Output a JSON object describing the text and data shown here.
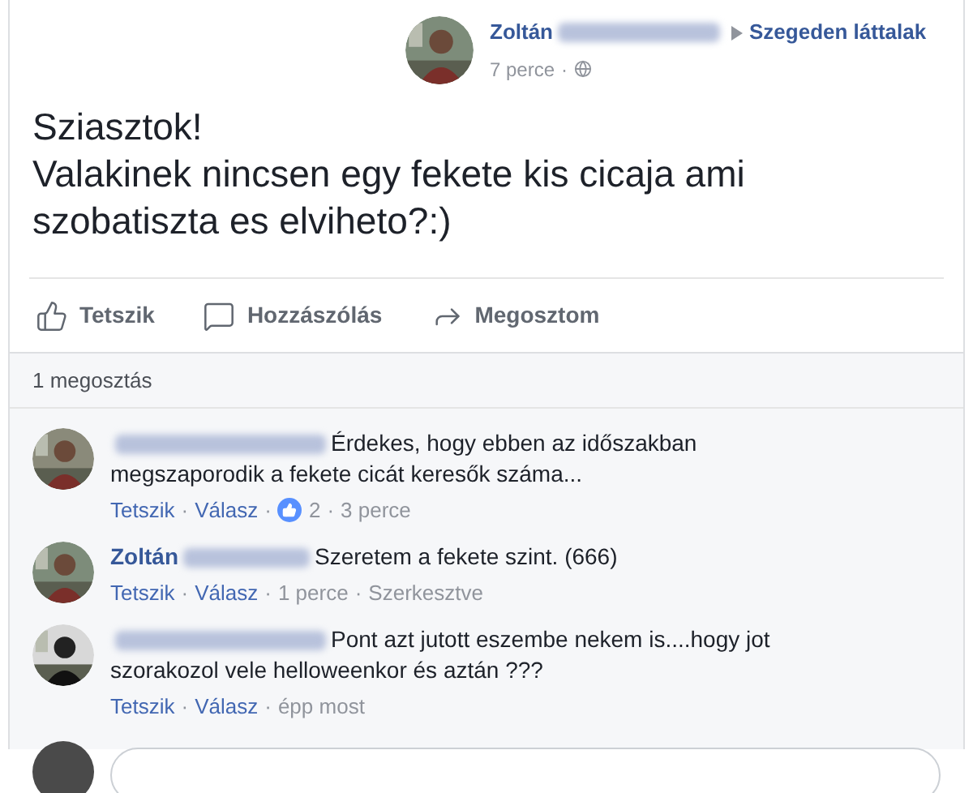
{
  "post": {
    "author": "Zoltán",
    "target": "Szegeden láttalak",
    "time": "7 perce",
    "separator": "·",
    "text_lines": [
      "Sziasztok!",
      "Valakinek nincsen egy fekete kis cicaja ami szobatiszta es elviheto?:)"
    ]
  },
  "actions": [
    "Tetszik",
    "Hozzászólás",
    "Megosztom"
  ],
  "shares": "1 megosztás",
  "comments": [
    {
      "text": "Érdekes, hogy ebben az időszakban megszaporodik a fekete cicát keresők száma...",
      "meta": [
        {
          "kind": "link",
          "text": "Tetszik"
        },
        {
          "kind": "sep",
          "text": "·"
        },
        {
          "kind": "link",
          "text": "Válasz"
        },
        {
          "kind": "sep",
          "text": "·"
        },
        {
          "kind": "likes",
          "text": "2"
        },
        {
          "kind": "sep",
          "text": "·"
        },
        {
          "kind": "time",
          "text": "3 perce"
        }
      ]
    },
    {
      "author_visible": "Zoltán",
      "text": "Szeretem a fekete szint. (666)",
      "meta": [
        {
          "kind": "link",
          "text": "Tetszik"
        },
        {
          "kind": "sep",
          "text": "·"
        },
        {
          "kind": "link",
          "text": "Válasz"
        },
        {
          "kind": "sep",
          "text": "·"
        },
        {
          "kind": "time",
          "text": "1 perce"
        },
        {
          "kind": "sep",
          "text": "·"
        },
        {
          "kind": "time",
          "text": "Szerkesztve"
        }
      ]
    },
    {
      "text": "Pont azt jutott eszembe nekem is....hogy jot szorakozol vele helloweenkor és aztán ???",
      "meta": [
        {
          "kind": "link",
          "text": "Tetszik"
        },
        {
          "kind": "sep",
          "text": "·"
        },
        {
          "kind": "link",
          "text": "Válasz"
        },
        {
          "kind": "sep",
          "text": "·"
        },
        {
          "kind": "time",
          "text": "épp most"
        }
      ]
    }
  ]
}
